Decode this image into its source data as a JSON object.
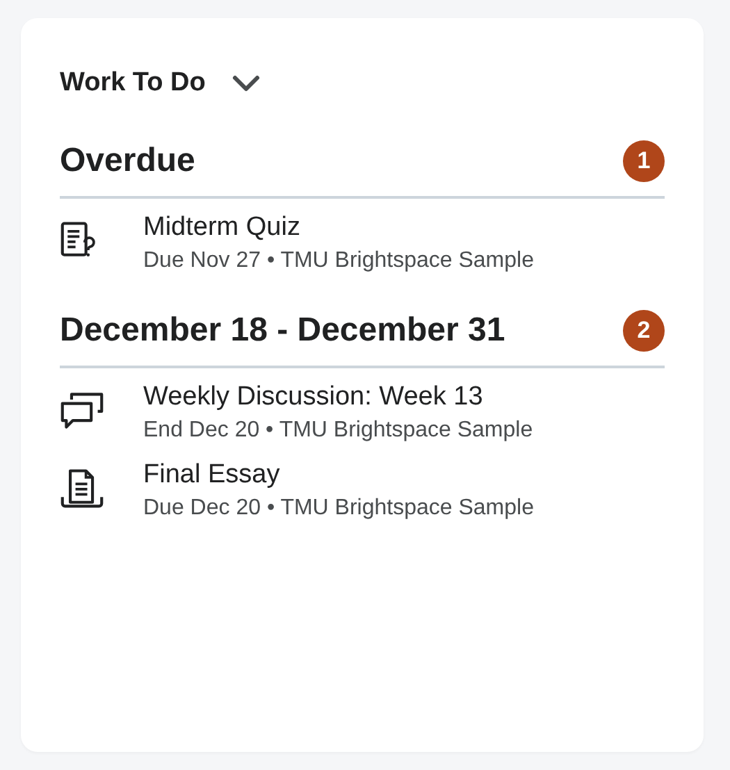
{
  "widget": {
    "title": "Work To Do",
    "expanded": true
  },
  "sections": [
    {
      "heading": "Overdue",
      "count": "1",
      "items": [
        {
          "kind": "quiz",
          "name": "Midterm Quiz",
          "meta": "Due Nov 27 • TMU Brightspace Sample"
        }
      ]
    },
    {
      "heading": "December 18 - December 31",
      "count": "2",
      "items": [
        {
          "kind": "discussion",
          "name": "Weekly Discussion: Week 13",
          "meta": "End Dec 20 • TMU Brightspace Sample"
        },
        {
          "kind": "assignment",
          "name": "Final Essay",
          "meta": "Due Dec 20 • TMU Brightspace Sample"
        }
      ]
    }
  ]
}
